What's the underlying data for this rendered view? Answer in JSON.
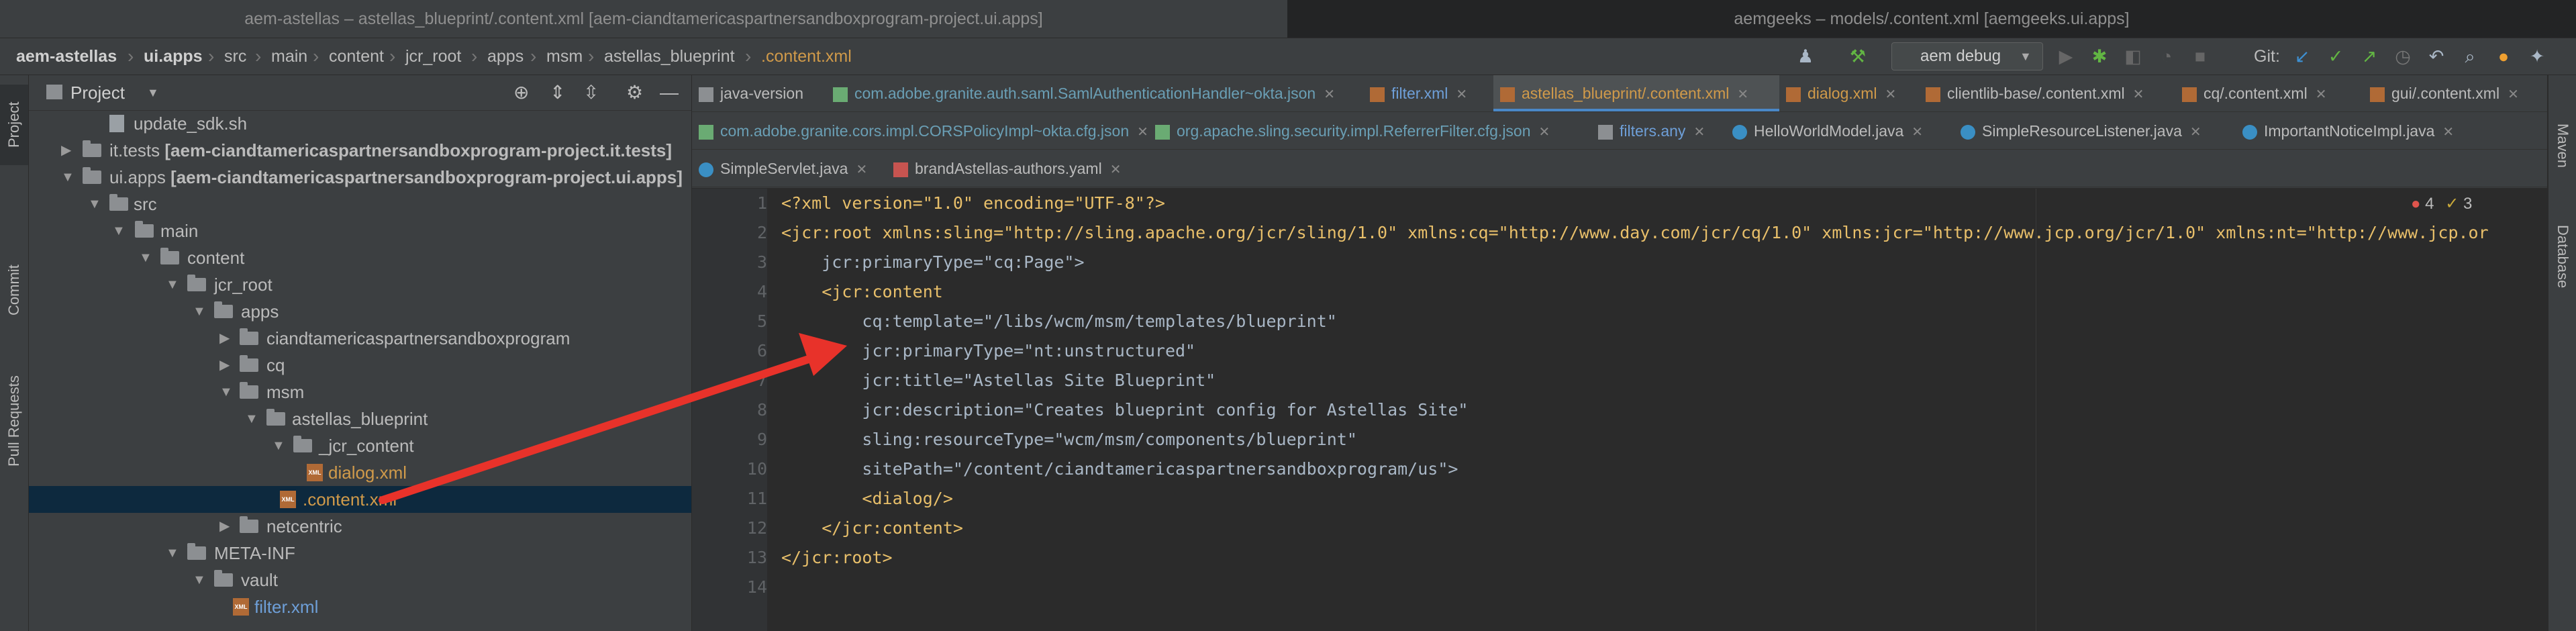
{
  "windows": {
    "left_title": "aem-astellas – astellas_blueprint/.content.xml [aem-ciandtamericaspartnersandboxprogram-project.ui.apps]",
    "right_title": "aemgeeks – models/.content.xml [aemgeeks.ui.apps]"
  },
  "breadcrumb": [
    "aem-astellas",
    "ui.apps",
    "src",
    "main",
    "content",
    "jcr_root",
    "apps",
    "msm",
    "astellas_blueprint",
    ".content.xml"
  ],
  "toolbar": {
    "run_config": "aem debug",
    "git_label": "Git:"
  },
  "left_strip": [
    "Project",
    "Commit",
    "Pull Requests"
  ],
  "right_strip": [
    "Maven",
    "Database"
  ],
  "project_panel": {
    "title": "Project",
    "tree": [
      {
        "label": "update_sdk.sh",
        "level": 3,
        "type": "file"
      },
      {
        "label": "it.tests",
        "suffix": " [aem-ciandtamericaspartnersandboxprogram-project.it.tests]",
        "level": 1,
        "type": "folder",
        "expanded": false
      },
      {
        "label": "ui.apps",
        "suffix": " [aem-ciandtamericaspartnersandboxprogram-project.ui.apps]",
        "level": 1,
        "type": "folder",
        "expanded": true
      },
      {
        "label": "src",
        "level": 2,
        "type": "folder",
        "expanded": true
      },
      {
        "label": "main",
        "level": 3,
        "type": "folder",
        "expanded": true
      },
      {
        "label": "content",
        "level": 4,
        "type": "folder",
        "expanded": true
      },
      {
        "label": "jcr_root",
        "level": 5,
        "type": "folder",
        "expanded": true
      },
      {
        "label": "apps",
        "level": 6,
        "type": "folder",
        "expanded": true
      },
      {
        "label": "ciandtamericaspartnersandboxprogram",
        "level": 7,
        "type": "folder",
        "expanded": false
      },
      {
        "label": "cq",
        "level": 7,
        "type": "folder",
        "expanded": false
      },
      {
        "label": "msm",
        "level": 7,
        "type": "folder",
        "expanded": true
      },
      {
        "label": "astellas_blueprint",
        "level": 8,
        "type": "folder",
        "expanded": true
      },
      {
        "label": "_jcr_content",
        "level": 9,
        "type": "folder",
        "expanded": true
      },
      {
        "label": "dialog.xml",
        "level": 10,
        "type": "xml",
        "color": "orange"
      },
      {
        "label": ".content.xml",
        "level": 9,
        "type": "xml",
        "color": "orange",
        "selected": true
      },
      {
        "label": "netcentric",
        "level": 7,
        "type": "folder",
        "expanded": false
      },
      {
        "label": "META-INF",
        "level": 5,
        "type": "folder",
        "expanded": true
      },
      {
        "label": "vault",
        "level": 6,
        "type": "folder",
        "expanded": true
      },
      {
        "label": "filter.xml",
        "level": 7,
        "type": "xml",
        "color": "blue"
      }
    ]
  },
  "tabs": {
    "row1": [
      "java-version",
      "com.adobe.granite.auth.saml.SamlAuthenticationHandler~okta.json",
      "filter.xml",
      "astellas_blueprint/.content.xml",
      "dialog.xml",
      "clientlib-base/.content.xml",
      "cq/.content.xml",
      "gui/.content.xml"
    ],
    "row2": [
      "com.adobe.granite.cors.impl.CORSPolicyImpl~okta.cfg.json",
      "org.apache.sling.security.impl.ReferrerFilter.cfg.json",
      "filters.any",
      "HelloWorldModel.java",
      "SimpleResourceListener.java",
      "ImportantNoticeImpl.java"
    ],
    "row3": [
      "SimpleServlet.java",
      "brandAstellas-authors.yaml"
    ]
  },
  "editor": {
    "line_numbers": [
      "1",
      "2",
      "3",
      "4",
      "5",
      "6",
      "7",
      "8",
      "9",
      "10",
      "11",
      "12",
      "13",
      "14"
    ],
    "errors": "4",
    "warnings": "3",
    "lines": [
      "<?xml version=\"1.0\" encoding=\"UTF-8\"?>",
      "<jcr:root xmlns:sling=\"http://sling.apache.org/jcr/sling/1.0\" xmlns:cq=\"http://www.day.com/jcr/cq/1.0\" xmlns:jcr=\"http://www.jcp.org/jcr/1.0\" xmlns:nt=\"http://www.jcp.or",
      "    jcr:primaryType=\"cq:Page\">",
      "    <jcr:content",
      "        cq:template=\"/libs/wcm/msm/templates/blueprint\"",
      "        jcr:primaryType=\"nt:unstructured\"",
      "        jcr:title=\"Astellas Site Blueprint\"",
      "        jcr:description=\"Creates blueprint config for Astellas Site\"",
      "        sling:resourceType=\"wcm/msm/components/blueprint\"",
      "        sitePath=\"/content/ciandtamericaspartnersandboxprogram/us\">",
      "        <dialog/>",
      "    </jcr:content>",
      "</jcr:root>",
      ""
    ]
  },
  "colors": {
    "annotation_arrow": "#e8322a",
    "selection": "#0d293e",
    "accent": "#4a88c7"
  }
}
